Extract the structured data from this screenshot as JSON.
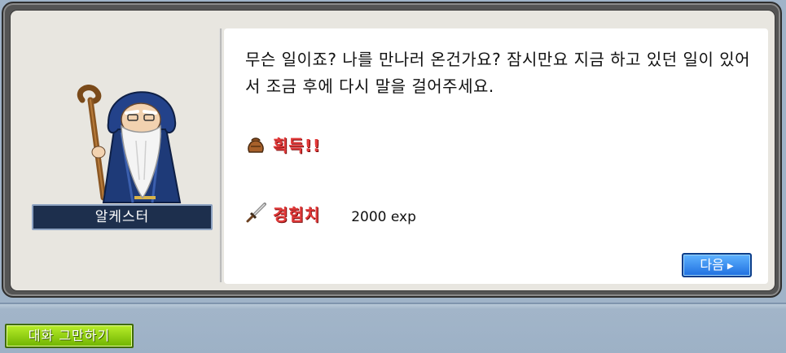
{
  "npc": {
    "name": "알케스터",
    "portrait_icon": "wizard-npc-portrait-icon"
  },
  "dialog": {
    "message": "무슨 일이죠? 나를 만나러 온건가요? 잠시만요 지금 하고 있던 일이 있어서 조금 후에 다시 말을 걸어주세요.",
    "acquire_label": "획득!!",
    "acquire_icon": "item-bag-icon",
    "exp_label": "경험치",
    "exp_icon": "sword-icon",
    "exp_value": "2000 exp",
    "next_button": "다음"
  },
  "bottom_bar": {
    "end_chat_button": "대화 그만하기"
  },
  "colors": {
    "reward_label": "#e23a3a",
    "next_button": "#1f6fe0",
    "end_chat_button": "#8fd000",
    "name_plate": "#1d2f4d"
  }
}
